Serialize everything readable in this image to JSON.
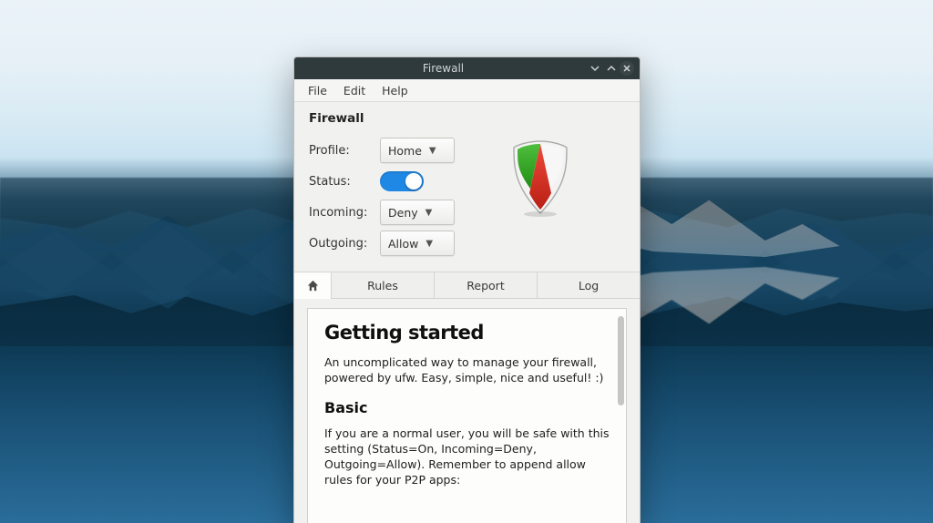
{
  "window": {
    "title": "Firewall"
  },
  "menubar": {
    "file": "File",
    "edit": "Edit",
    "help": "Help"
  },
  "panel": {
    "heading": "Firewall",
    "profile_label": "Profile:",
    "profile_value": "Home",
    "status_label": "Status:",
    "status_on": true,
    "incoming_label": "Incoming:",
    "incoming_value": "Deny",
    "outgoing_label": "Outgoing:",
    "outgoing_value": "Allow"
  },
  "tabs": {
    "home_icon": "home-icon",
    "rules": "Rules",
    "report": "Report",
    "log": "Log"
  },
  "doc": {
    "h1": "Getting started",
    "intro": "An uncomplicated way to manage your firewall, powered by ufw. Easy, simple, nice and useful! :)",
    "h2": "Basic",
    "basic": "If you are a normal user, you will be safe with this setting (Status=On, Incoming=Deny, Outgoing=Allow). Remember to append allow rules for your P2P apps:"
  }
}
